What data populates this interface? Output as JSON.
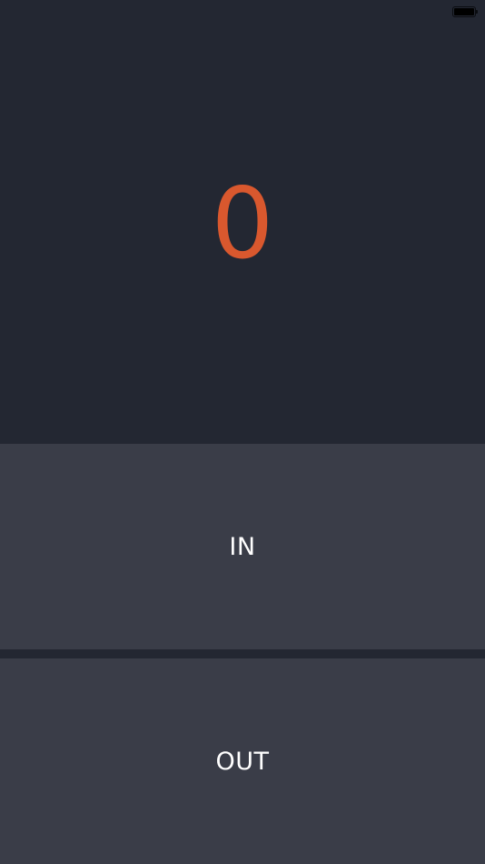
{
  "status_bar": {
    "battery_icon": "battery-full-icon"
  },
  "counter": {
    "value": "0",
    "color": "#d9582e"
  },
  "actions": {
    "in_label": "IN",
    "out_label": "OUT"
  },
  "colors": {
    "background": "#232732",
    "button": "#3a3d48",
    "label": "#ffffff"
  }
}
